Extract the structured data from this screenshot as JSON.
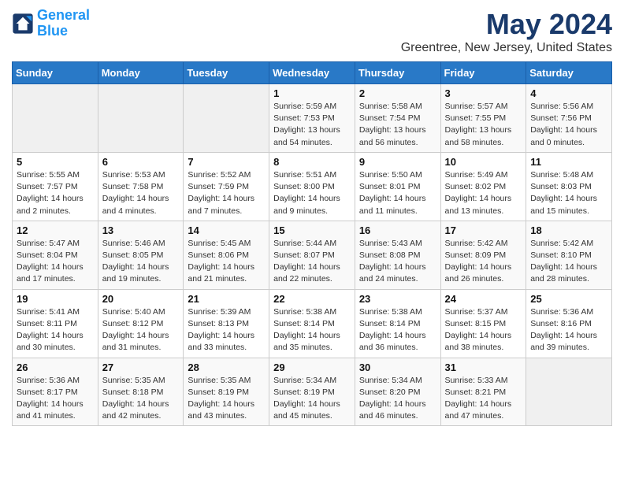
{
  "header": {
    "logo_line1": "General",
    "logo_line2": "Blue",
    "title": "May 2024",
    "subtitle": "Greentree, New Jersey, United States"
  },
  "days_of_week": [
    "Sunday",
    "Monday",
    "Tuesday",
    "Wednesday",
    "Thursday",
    "Friday",
    "Saturday"
  ],
  "weeks": [
    [
      {
        "day": "",
        "info": ""
      },
      {
        "day": "",
        "info": ""
      },
      {
        "day": "",
        "info": ""
      },
      {
        "day": "1",
        "info": "Sunrise: 5:59 AM\nSunset: 7:53 PM\nDaylight: 13 hours and 54 minutes."
      },
      {
        "day": "2",
        "info": "Sunrise: 5:58 AM\nSunset: 7:54 PM\nDaylight: 13 hours and 56 minutes."
      },
      {
        "day": "3",
        "info": "Sunrise: 5:57 AM\nSunset: 7:55 PM\nDaylight: 13 hours and 58 minutes."
      },
      {
        "day": "4",
        "info": "Sunrise: 5:56 AM\nSunset: 7:56 PM\nDaylight: 14 hours and 0 minutes."
      }
    ],
    [
      {
        "day": "5",
        "info": "Sunrise: 5:55 AM\nSunset: 7:57 PM\nDaylight: 14 hours and 2 minutes."
      },
      {
        "day": "6",
        "info": "Sunrise: 5:53 AM\nSunset: 7:58 PM\nDaylight: 14 hours and 4 minutes."
      },
      {
        "day": "7",
        "info": "Sunrise: 5:52 AM\nSunset: 7:59 PM\nDaylight: 14 hours and 7 minutes."
      },
      {
        "day": "8",
        "info": "Sunrise: 5:51 AM\nSunset: 8:00 PM\nDaylight: 14 hours and 9 minutes."
      },
      {
        "day": "9",
        "info": "Sunrise: 5:50 AM\nSunset: 8:01 PM\nDaylight: 14 hours and 11 minutes."
      },
      {
        "day": "10",
        "info": "Sunrise: 5:49 AM\nSunset: 8:02 PM\nDaylight: 14 hours and 13 minutes."
      },
      {
        "day": "11",
        "info": "Sunrise: 5:48 AM\nSunset: 8:03 PM\nDaylight: 14 hours and 15 minutes."
      }
    ],
    [
      {
        "day": "12",
        "info": "Sunrise: 5:47 AM\nSunset: 8:04 PM\nDaylight: 14 hours and 17 minutes."
      },
      {
        "day": "13",
        "info": "Sunrise: 5:46 AM\nSunset: 8:05 PM\nDaylight: 14 hours and 19 minutes."
      },
      {
        "day": "14",
        "info": "Sunrise: 5:45 AM\nSunset: 8:06 PM\nDaylight: 14 hours and 21 minutes."
      },
      {
        "day": "15",
        "info": "Sunrise: 5:44 AM\nSunset: 8:07 PM\nDaylight: 14 hours and 22 minutes."
      },
      {
        "day": "16",
        "info": "Sunrise: 5:43 AM\nSunset: 8:08 PM\nDaylight: 14 hours and 24 minutes."
      },
      {
        "day": "17",
        "info": "Sunrise: 5:42 AM\nSunset: 8:09 PM\nDaylight: 14 hours and 26 minutes."
      },
      {
        "day": "18",
        "info": "Sunrise: 5:42 AM\nSunset: 8:10 PM\nDaylight: 14 hours and 28 minutes."
      }
    ],
    [
      {
        "day": "19",
        "info": "Sunrise: 5:41 AM\nSunset: 8:11 PM\nDaylight: 14 hours and 30 minutes."
      },
      {
        "day": "20",
        "info": "Sunrise: 5:40 AM\nSunset: 8:12 PM\nDaylight: 14 hours and 31 minutes."
      },
      {
        "day": "21",
        "info": "Sunrise: 5:39 AM\nSunset: 8:13 PM\nDaylight: 14 hours and 33 minutes."
      },
      {
        "day": "22",
        "info": "Sunrise: 5:38 AM\nSunset: 8:14 PM\nDaylight: 14 hours and 35 minutes."
      },
      {
        "day": "23",
        "info": "Sunrise: 5:38 AM\nSunset: 8:14 PM\nDaylight: 14 hours and 36 minutes."
      },
      {
        "day": "24",
        "info": "Sunrise: 5:37 AM\nSunset: 8:15 PM\nDaylight: 14 hours and 38 minutes."
      },
      {
        "day": "25",
        "info": "Sunrise: 5:36 AM\nSunset: 8:16 PM\nDaylight: 14 hours and 39 minutes."
      }
    ],
    [
      {
        "day": "26",
        "info": "Sunrise: 5:36 AM\nSunset: 8:17 PM\nDaylight: 14 hours and 41 minutes."
      },
      {
        "day": "27",
        "info": "Sunrise: 5:35 AM\nSunset: 8:18 PM\nDaylight: 14 hours and 42 minutes."
      },
      {
        "day": "28",
        "info": "Sunrise: 5:35 AM\nSunset: 8:19 PM\nDaylight: 14 hours and 43 minutes."
      },
      {
        "day": "29",
        "info": "Sunrise: 5:34 AM\nSunset: 8:19 PM\nDaylight: 14 hours and 45 minutes."
      },
      {
        "day": "30",
        "info": "Sunrise: 5:34 AM\nSunset: 8:20 PM\nDaylight: 14 hours and 46 minutes."
      },
      {
        "day": "31",
        "info": "Sunrise: 5:33 AM\nSunset: 8:21 PM\nDaylight: 14 hours and 47 minutes."
      },
      {
        "day": "",
        "info": ""
      }
    ]
  ]
}
